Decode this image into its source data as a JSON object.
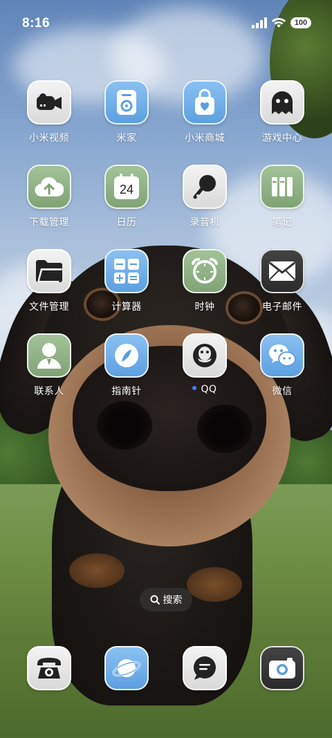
{
  "status_bar": {
    "time": "8:16",
    "battery": "100",
    "icons": [
      "signal-icon",
      "wifi-icon",
      "battery-icon"
    ]
  },
  "apps": [
    {
      "label": "小米视频",
      "icon": "video-camera-icon",
      "bg": "white"
    },
    {
      "label": "米家",
      "icon": "smart-speaker-icon",
      "bg": "blue"
    },
    {
      "label": "小米商城",
      "icon": "shopping-bag-icon",
      "bg": "blue"
    },
    {
      "label": "游戏中心",
      "icon": "ghost-icon",
      "bg": "white"
    },
    {
      "label": "下载管理",
      "icon": "cloud-download-icon",
      "bg": "green"
    },
    {
      "label": "日历",
      "icon": "calendar-icon",
      "bg": "green",
      "calendar_day": "24"
    },
    {
      "label": "录音机",
      "icon": "microphone-icon",
      "bg": "white"
    },
    {
      "label": "笔记",
      "icon": "notebook-icon",
      "bg": "green"
    },
    {
      "label": "文件管理",
      "icon": "folder-icon",
      "bg": "white"
    },
    {
      "label": "计算器",
      "icon": "calculator-icon",
      "bg": "blue"
    },
    {
      "label": "时钟",
      "icon": "alarm-clock-icon",
      "bg": "green"
    },
    {
      "label": "电子邮件",
      "icon": "envelope-icon",
      "bg": "dark"
    },
    {
      "label": "联系人",
      "icon": "contact-person-icon",
      "bg": "green"
    },
    {
      "label": "指南针",
      "icon": "compass-icon",
      "bg": "blue"
    },
    {
      "label": "QQ",
      "icon": "qq-penguin-icon",
      "bg": "white",
      "new_badge": true
    },
    {
      "label": "微信",
      "icon": "wechat-icon",
      "bg": "blue"
    }
  ],
  "search": {
    "label": "搜索",
    "icon": "search-icon"
  },
  "dock": [
    {
      "name": "phone",
      "icon": "telephone-icon",
      "bg": "white"
    },
    {
      "name": "browser",
      "icon": "planet-icon",
      "bg": "blue"
    },
    {
      "name": "messages",
      "icon": "chat-bubble-icon",
      "bg": "white"
    },
    {
      "name": "camera",
      "icon": "camera-icon",
      "bg": "dark"
    }
  ],
  "colors": {
    "accent_blue": "#5b9ee0",
    "accent_green": "#7fa274",
    "badge_dot": "#4a7dff"
  }
}
